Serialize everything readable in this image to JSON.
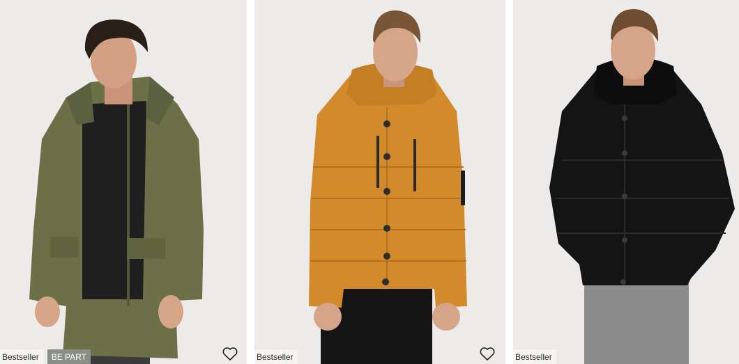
{
  "products": [
    {
      "badges": [
        "Bestseller",
        "BE PART"
      ],
      "jacket_color": "#6b7047",
      "wishlist_icon": "heart-outline-icon"
    },
    {
      "badges": [
        "Bestseller"
      ],
      "jacket_color": "#d28a2a",
      "wishlist_icon": "heart-outline-icon"
    },
    {
      "badges": [
        "Bestseller"
      ],
      "jacket_color": "#141414",
      "wishlist_icon": "heart-outline-icon"
    }
  ],
  "colors": {
    "card_bg": "#eeedeb",
    "badge_bg": "#f5f4f2",
    "badge_dark_bg": "#8a8f86"
  }
}
